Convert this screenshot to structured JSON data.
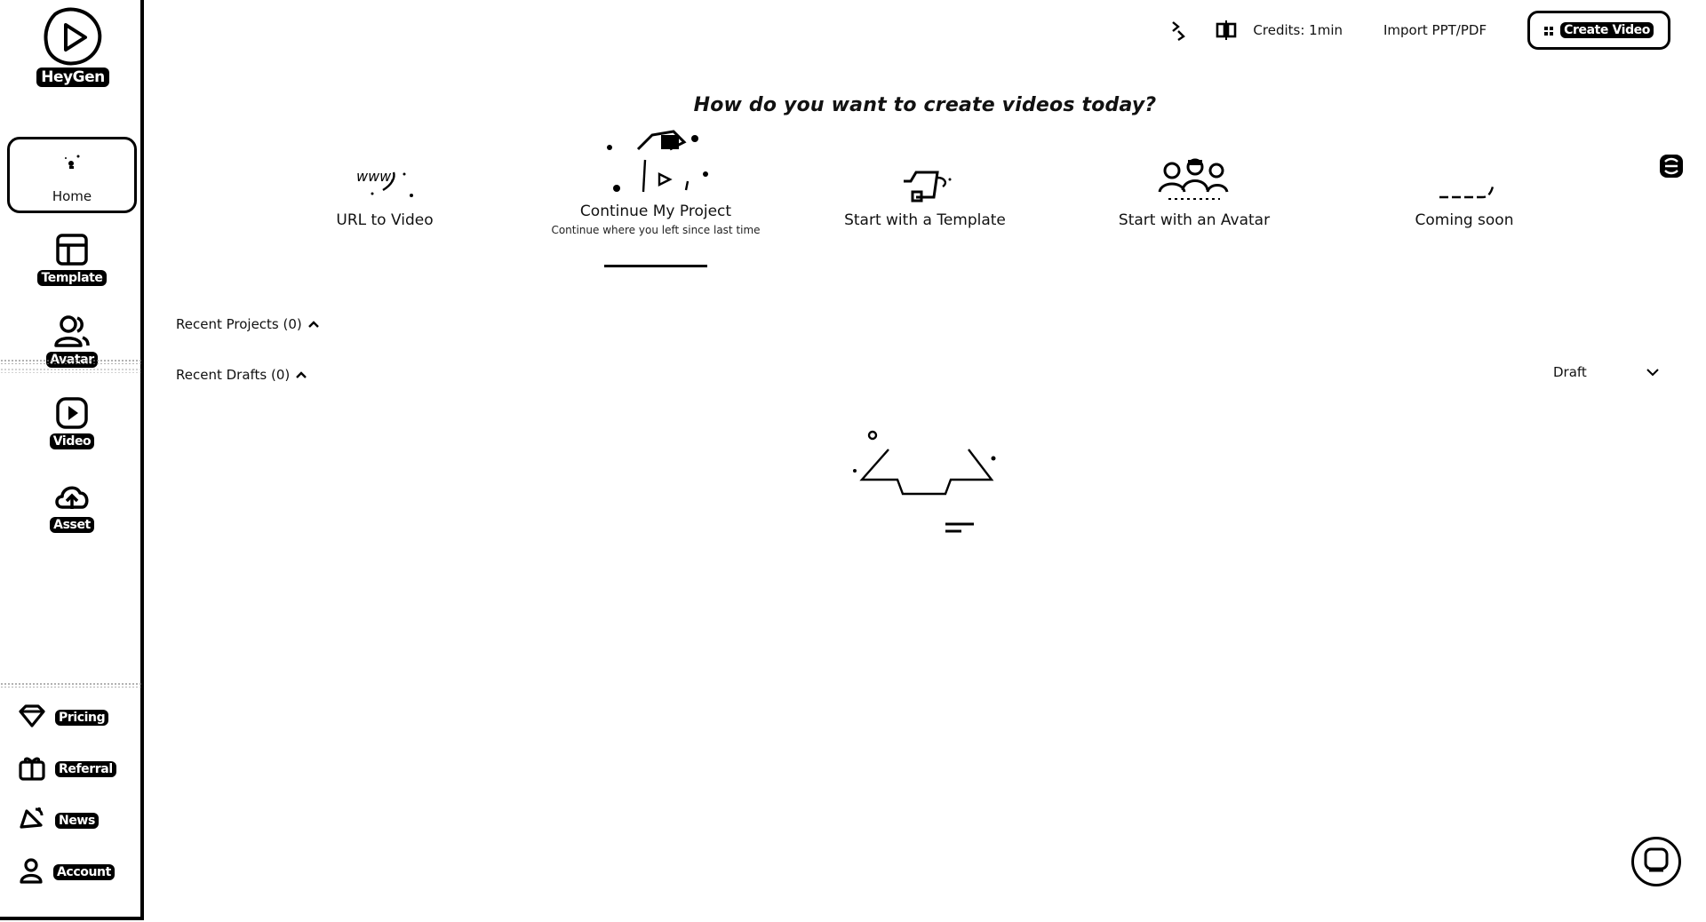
{
  "sidebar": {
    "brand": "HeyGen",
    "nav": [
      {
        "label": "Home",
        "icon": "home-icon"
      },
      {
        "label": "Template",
        "icon": "template-icon"
      },
      {
        "label": "Avatar",
        "icon": "avatar-icon"
      },
      {
        "label": "Video",
        "icon": "video-icon"
      },
      {
        "label": "Asset",
        "icon": "upload-cloud-icon"
      }
    ],
    "bottom": [
      {
        "label": "Pricing",
        "icon": "diamond-icon"
      },
      {
        "label": "Referral",
        "icon": "gift-icon"
      },
      {
        "label": "News",
        "icon": "news-icon"
      },
      {
        "label": "Account",
        "icon": "user-icon"
      }
    ]
  },
  "topbar": {
    "credits": "Credits: 1min",
    "import_label": "Import PPT/PDF",
    "create_label": "Create Video"
  },
  "hero": {
    "title": "How do you want to create videos today?",
    "options": [
      {
        "label": "URL to Video",
        "sub": ""
      },
      {
        "label": "Continue My Project",
        "sub": "Continue where you left since last time"
      },
      {
        "label": "Start with a Template",
        "sub": ""
      },
      {
        "label": "Start with an Avatar",
        "sub": ""
      },
      {
        "label": "Coming soon",
        "sub": ""
      }
    ]
  },
  "sections": {
    "recent_projects": "Recent Projects (0)",
    "recent_drafts": "Recent Drafts (0)",
    "draft_filter": "Draft"
  },
  "colors": {
    "ink": "#000000",
    "background": "#ffffff"
  }
}
